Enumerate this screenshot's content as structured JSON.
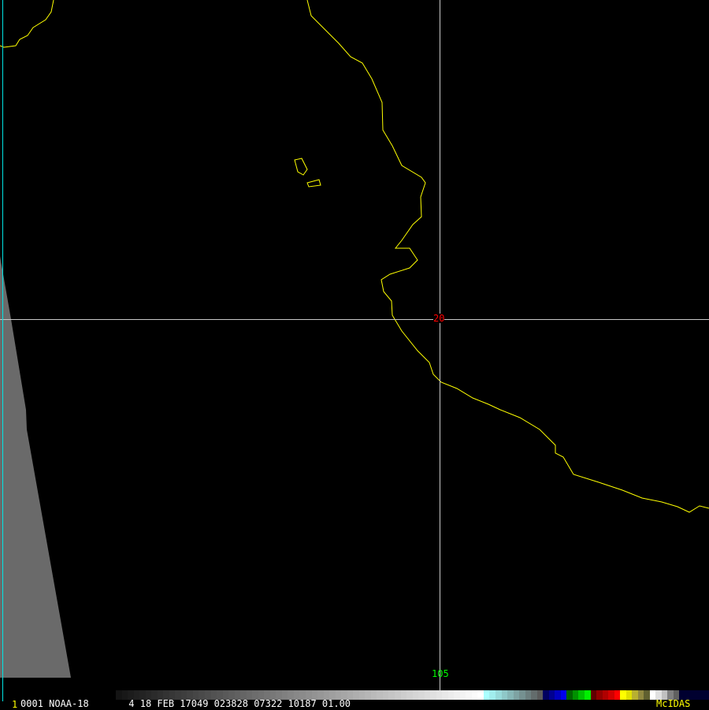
{
  "image": {
    "frame_number": "1",
    "info_line": "0001 NOAA-18       4 18 FEB 17049 023828 07322 10187 01.00",
    "brand": "McIDAS"
  },
  "grid": {
    "lat_label": "20",
    "lon_label": "105"
  },
  "colors": {
    "coastline": "#ffff00",
    "grid_line": "#c8c8c8",
    "lat_label": "#ff0000",
    "lon_label": "#00ff00",
    "border": "#00e5e5"
  }
}
